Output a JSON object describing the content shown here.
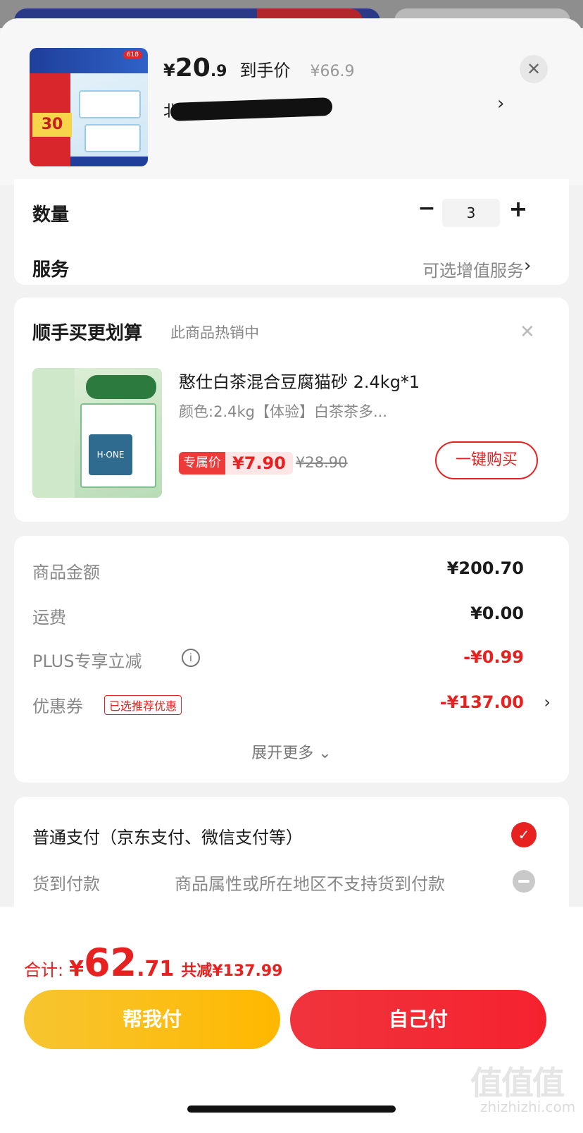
{
  "header": {
    "price_currency": "¥",
    "price_int": "20",
    "price_dec": ".9",
    "price_label": "到手价",
    "original_price": "¥66.9",
    "address_visible": "北",
    "thumb_tag": "618",
    "thumb_price": "30"
  },
  "quantity": {
    "label": "数量",
    "value": "3"
  },
  "service": {
    "label": "服务",
    "value": "可选增值服务"
  },
  "recommend": {
    "title": "顺手买更划算",
    "subtitle": "此商品热销中",
    "product_name": "憨仕白茶混合豆腐猫砂 2.4kg*1",
    "spec": "颜色:2.4kg【体验】白茶茶多...",
    "badge_label": "专属价",
    "price": "¥7.90",
    "original_price": "¥28.90",
    "buy_button": "一键购买",
    "img_brand": "H·ONE"
  },
  "summary": {
    "rows": [
      {
        "label": "商品金额",
        "value": "¥200.70"
      },
      {
        "label": "运费",
        "value": "¥0.00"
      },
      {
        "label": "PLUS专享立减",
        "value": "-¥0.99"
      },
      {
        "label": "优惠券",
        "tag": "已选推荐优惠",
        "value": "-¥137.00"
      }
    ],
    "expand": "展开更多 ⌄"
  },
  "payment": {
    "option1": "普通支付（京东支付、微信支付等）",
    "option2": "货到付款",
    "option2_note": "商品属性或所在地区不支持货到付款"
  },
  "footer": {
    "total_label": "合计:",
    "total_currency": "¥",
    "total_int": "62",
    "total_dec": ".71",
    "saved": "共减¥137.99",
    "help_pay": "帮我付",
    "self_pay": "自己付"
  },
  "watermark": {
    "logo": "值值值",
    "site": "zhizhizhi.com"
  },
  "colors": {
    "accent_red": "#e6211f",
    "help_yellow": "#f7c531",
    "self_red": "#f0343d"
  }
}
